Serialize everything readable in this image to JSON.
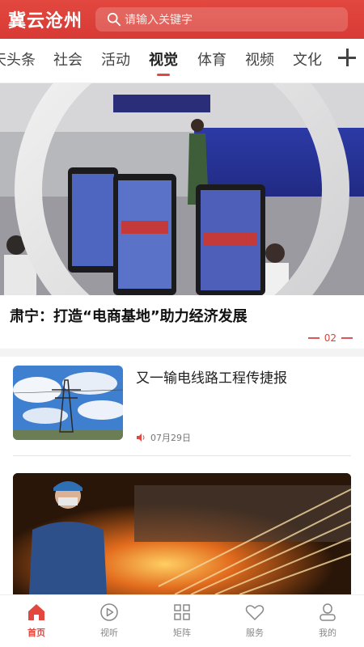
{
  "header": {
    "logo": "冀云沧州",
    "search_placeholder": "请输入关键字"
  },
  "tabs": [
    {
      "label": "天头条"
    },
    {
      "label": "社会"
    },
    {
      "label": "活动"
    },
    {
      "label": "视觉"
    },
    {
      "label": "体育"
    },
    {
      "label": "视频"
    },
    {
      "label": "文化"
    }
  ],
  "active_tab": "视觉",
  "hero": {
    "title": "肃宁：打造“电商基地”助力经济发展",
    "page_indicator": "02"
  },
  "news_item": {
    "title": "又一输电线路工程传捷报",
    "date": "07月29日",
    "audio_icon": "speaker-icon"
  },
  "bottom_nav": [
    {
      "label": "首页",
      "icon": "home-icon",
      "active": true
    },
    {
      "label": "视听",
      "icon": "play-circle-icon",
      "active": false
    },
    {
      "label": "矩阵",
      "icon": "grid-icon",
      "active": false
    },
    {
      "label": "服务",
      "icon": "heart-icon",
      "active": false
    },
    {
      "label": "我的",
      "icon": "user-icon",
      "active": false
    }
  ],
  "colors": {
    "brand": "#e2483f",
    "text": "#222222",
    "muted": "#888888"
  }
}
